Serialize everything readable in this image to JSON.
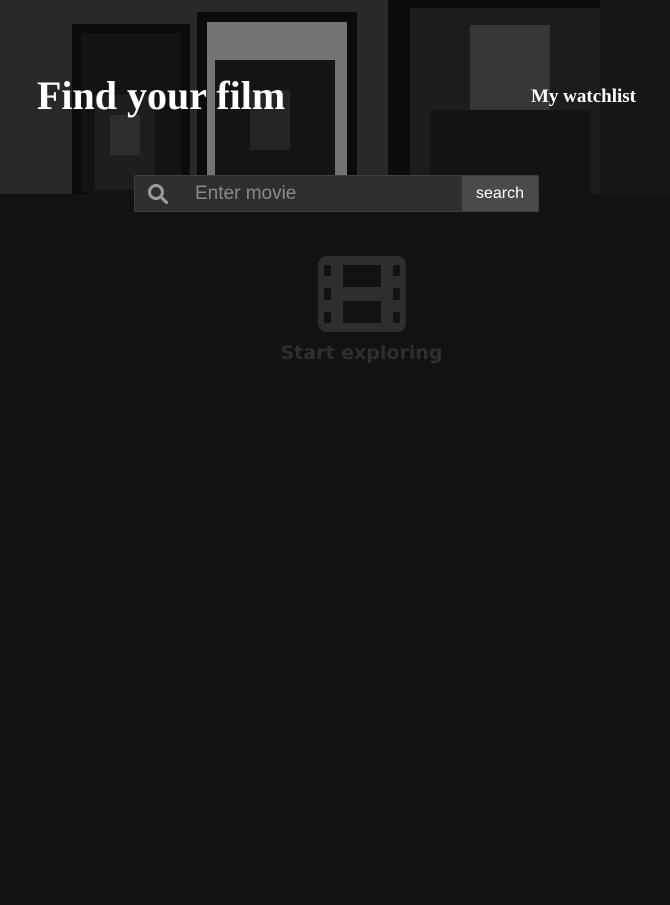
{
  "header": {
    "title": "Find your film",
    "watchlist_label": "My watchlist"
  },
  "search": {
    "icon": "search-icon",
    "placeholder": "Enter movie",
    "value": "",
    "button_label": "search"
  },
  "empty_state": {
    "icon": "film-icon",
    "message": "Start exploring"
  },
  "colors": {
    "page_background": "#121212",
    "search_background": "#2e2e2e",
    "search_button": "#4a4a4a",
    "empty_state": "#2e2e2e"
  }
}
